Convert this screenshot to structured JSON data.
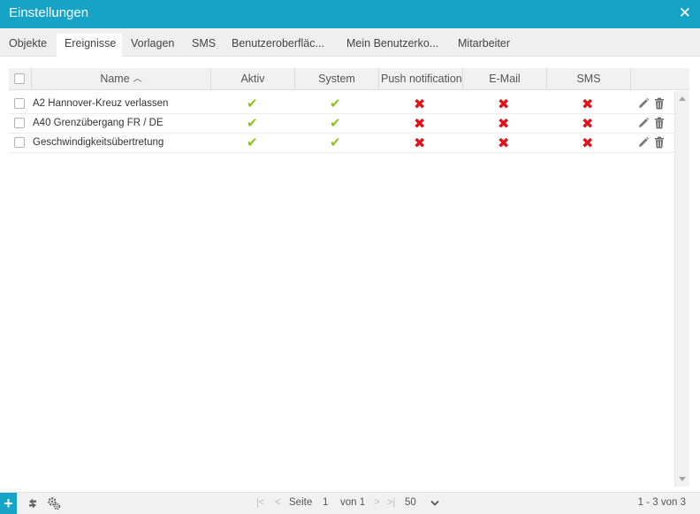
{
  "window": {
    "title": "Einstellungen",
    "close_glyph": "✕"
  },
  "tabs": [
    {
      "label": "Objekte"
    },
    {
      "label": "Ereignisse",
      "active": true
    },
    {
      "label": "Vorlagen"
    },
    {
      "label": "SMS"
    },
    {
      "label": "Benutzeroberfläc..."
    },
    {
      "label": "Mein Benutzerko..."
    },
    {
      "label": "Mitarbeiter"
    }
  ],
  "grid": {
    "columns": {
      "name": "Name",
      "aktiv": "Aktiv",
      "system": "System",
      "push": "Push notification",
      "email": "E-Mail",
      "sms": "SMS"
    },
    "sort_glyph": "︿",
    "rows": [
      {
        "name": "A2 Hannover-Kreuz verlassen",
        "aktiv": true,
        "system": true,
        "push": false,
        "email": false,
        "sms": false
      },
      {
        "name": "A40 Grenzübergang FR / DE",
        "aktiv": true,
        "system": true,
        "push": false,
        "email": false,
        "sms": false
      },
      {
        "name": "Geschwindigkeitsübertretung",
        "aktiv": true,
        "system": true,
        "push": false,
        "email": false,
        "sms": false
      }
    ]
  },
  "footer": {
    "add_glyph": "+",
    "page_label": "Seite",
    "page_value": "1",
    "of_label": "von 1",
    "page_size": "50",
    "range_text": "1 - 3 von 3"
  },
  "colors": {
    "accent": "#15a3c8",
    "ok": "#8dc21f",
    "error": "#e0121a"
  },
  "icons": [
    "close-icon",
    "sort-up-icon",
    "check-icon",
    "cross-icon",
    "pencil-icon",
    "trash-icon",
    "add-icon",
    "refresh-icon",
    "settings-icon",
    "first-page-icon",
    "prev-page-icon",
    "next-page-icon",
    "last-page-icon",
    "chevron-down-icon"
  ]
}
